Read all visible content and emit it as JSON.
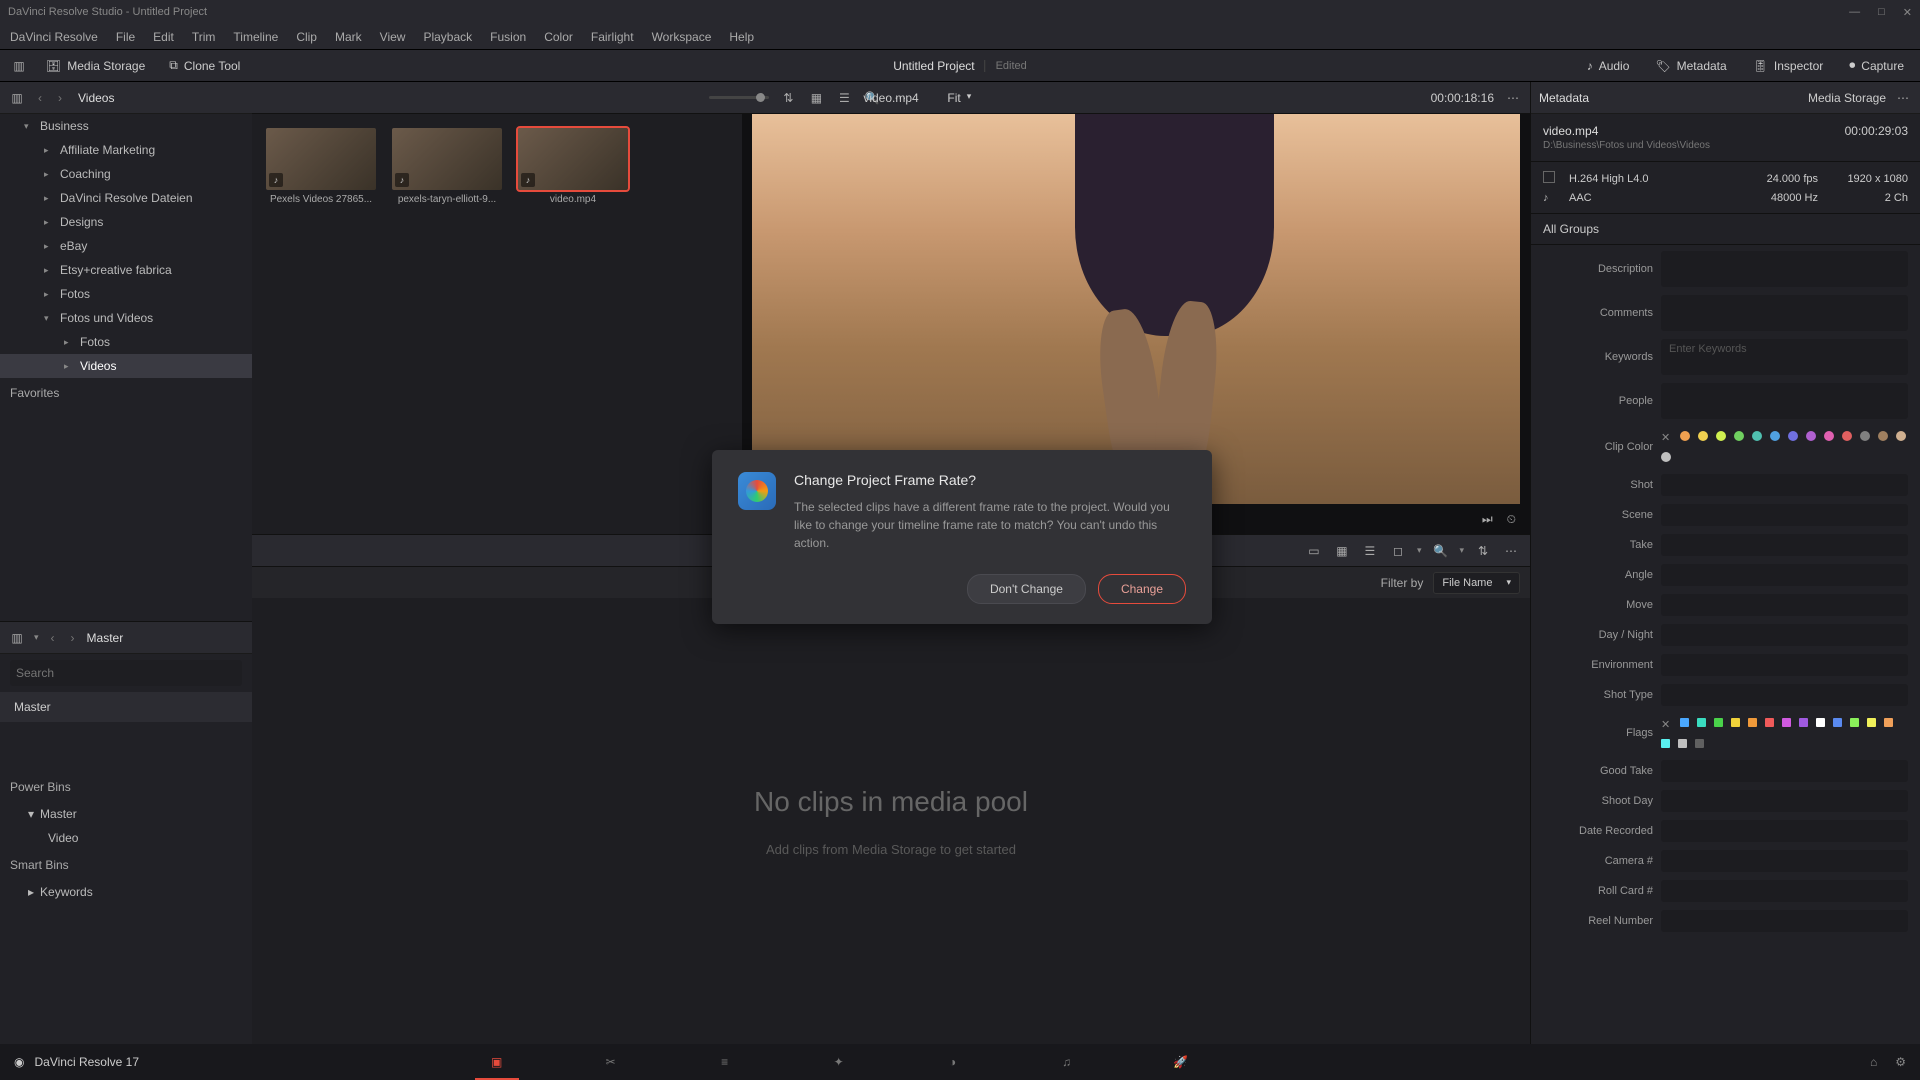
{
  "titlebar": {
    "text": "DaVinci Resolve Studio - Untitled Project"
  },
  "menu": [
    "DaVinci Resolve",
    "File",
    "Edit",
    "Trim",
    "Timeline",
    "Clip",
    "Mark",
    "View",
    "Playback",
    "Fusion",
    "Color",
    "Fairlight",
    "Workspace",
    "Help"
  ],
  "toolbar": {
    "mediaStorage": "Media Storage",
    "cloneTool": "Clone Tool",
    "projectName": "Untitled Project",
    "edited": "Edited",
    "audio": "Audio",
    "metadata": "Metadata",
    "inspector": "Inspector",
    "capture": "Capture"
  },
  "browserHeader": {
    "title": "Videos",
    "fit": "Fit"
  },
  "tree": [
    {
      "label": "Business",
      "expanded": true,
      "level": 0
    },
    {
      "label": "Affiliate Marketing",
      "level": 1
    },
    {
      "label": "Coaching",
      "level": 1
    },
    {
      "label": "DaVinci Resolve Dateien",
      "level": 1
    },
    {
      "label": "Designs",
      "level": 1
    },
    {
      "label": "eBay",
      "level": 1
    },
    {
      "label": "Etsy+creative fabrica",
      "level": 1
    },
    {
      "label": "Fotos",
      "level": 1
    },
    {
      "label": "Fotos und Videos",
      "expanded": true,
      "level": 1
    },
    {
      "label": "Fotos",
      "level": 2
    },
    {
      "label": "Videos",
      "level": 2,
      "active": true
    }
  ],
  "favorites": "Favorites",
  "thumbs": [
    {
      "label": "Pexels Videos 27865..."
    },
    {
      "label": "pexels-taryn-elliott-9..."
    },
    {
      "label": "video.mp4",
      "selected": true
    }
  ],
  "viewer": {
    "clipName": "video.mp4",
    "timecode": "00:00:18:16"
  },
  "masterPanel": {
    "title": "Master",
    "searchPlaceholder": "Search",
    "masterRow": "Master",
    "powerBins": "Power Bins",
    "pbMaster": "Master",
    "pbVideo": "Video",
    "smartBins": "Smart Bins",
    "keywords": "Keywords"
  },
  "pool": {
    "filterBy": "Filter by",
    "filterValue": "File Name",
    "empty": "No clips in media pool",
    "hint": "Add clips from Media Storage to get started"
  },
  "metadata": {
    "header": "Metadata",
    "storage": "Media Storage",
    "fileName": "video.mp4",
    "filePath": "D:\\Business\\Fotos und Videos\\Videos",
    "duration": "00:00:29:03",
    "vcodec": "H.264 High L4.0",
    "fps": "24.000 fps",
    "res": "1920 x 1080",
    "acodec": "AAC",
    "arate": "48000 Hz",
    "ach": "2 Ch",
    "allGroups": "All Groups",
    "fields": {
      "description": "Description",
      "comments": "Comments",
      "keywords": "Keywords",
      "keywordsPH": "Enter Keywords",
      "people": "People",
      "clipColor": "Clip Color",
      "shot": "Shot",
      "scene": "Scene",
      "take": "Take",
      "angle": "Angle",
      "move": "Move",
      "dayNight": "Day / Night",
      "environment": "Environment",
      "shotType": "Shot Type",
      "flags": "Flags",
      "goodTake": "Good Take",
      "shootDay": "Shoot Day",
      "dateRecorded": "Date Recorded",
      "cameraNum": "Camera #",
      "rollCard": "Roll Card #",
      "reelNumber": "Reel Number"
    }
  },
  "clipColors": [
    "#f0a050",
    "#f0d050",
    "#d0f050",
    "#70d060",
    "#50c0b0",
    "#50a0e0",
    "#7070e0",
    "#b060d0",
    "#e060b0",
    "#e06060",
    "#808080",
    "#a08060",
    "#d0b090",
    "#c0c0c0"
  ],
  "flagColors": [
    "#4aa8ff",
    "#3adcc0",
    "#4ad24a",
    "#f0d23a",
    "#f09a3a",
    "#f05a5a",
    "#d05ae0",
    "#a05ae0",
    "#ffffff",
    "#5a8af0",
    "#8af05a",
    "#f0f05a",
    "#f0a05a",
    "#5af0f0",
    "#c0c0c0",
    "#606060"
  ],
  "dialog": {
    "title": "Change Project Frame Rate?",
    "body": "The selected clips have a different frame rate to the project. Would you like to change your timeline frame rate to match? You can't undo this action.",
    "dont": "Don't Change",
    "change": "Change"
  },
  "status": {
    "version": "DaVinci Resolve 17"
  }
}
